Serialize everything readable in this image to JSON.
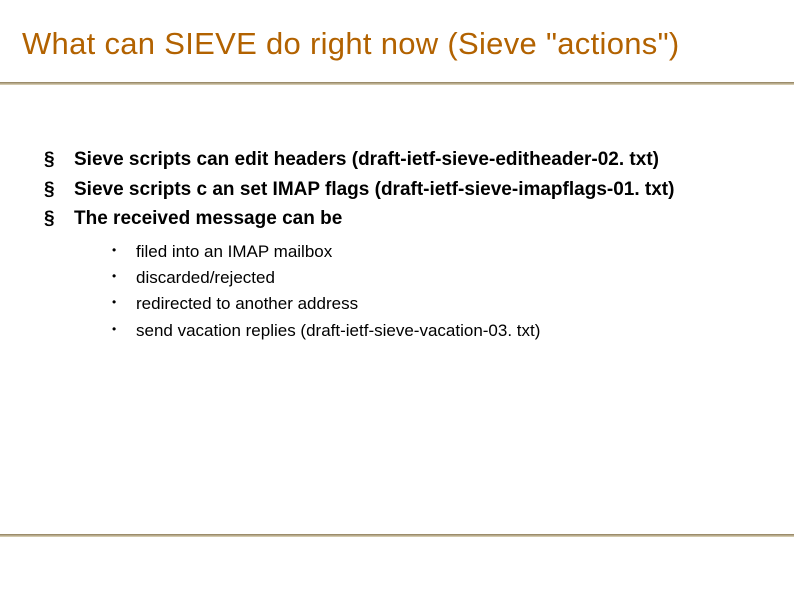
{
  "title": "What can SIEVE do right now (Sieve \"actions\")",
  "bullets": [
    {
      "text": "Sieve scripts can edit headers (draft-ietf-sieve-editheader-02. txt)"
    },
    {
      "text": "Sieve scripts c an set IMAP flags (draft-ietf-sieve-imapflags-01. txt)"
    },
    {
      "text": "The received message can be",
      "sub": [
        "filed into an IMAP mailbox",
        "discarded/rejected",
        "redirected to another address",
        "send vacation replies (draft-ietf-sieve-vacation-03. txt)"
      ]
    }
  ]
}
